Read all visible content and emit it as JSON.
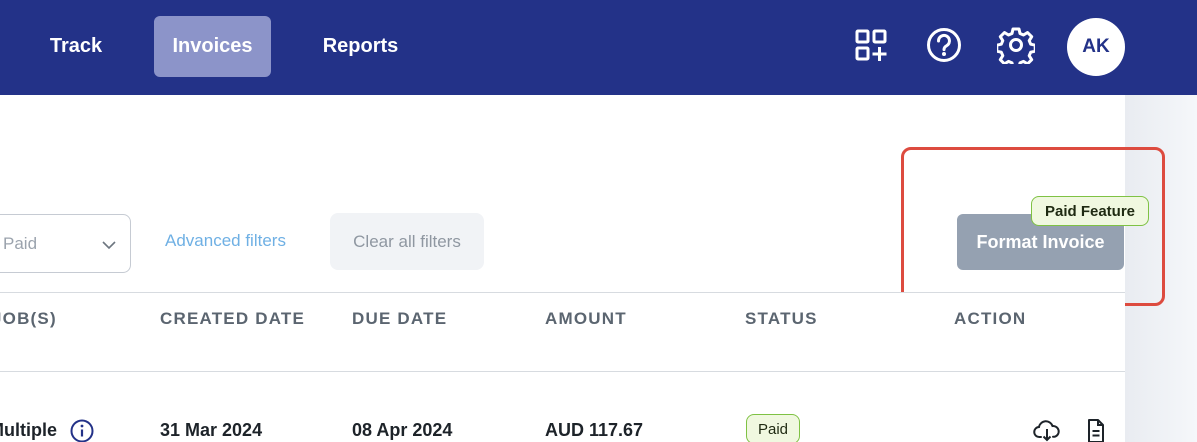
{
  "nav": {
    "items": [
      {
        "label": "Track"
      },
      {
        "label": "Invoices",
        "active": true
      },
      {
        "label": "Reports"
      }
    ],
    "icons": [
      "apps-add-icon",
      "help-icon",
      "settings-gear-icon"
    ],
    "avatar_initials": "AK"
  },
  "filters": {
    "status_value": "Paid",
    "advanced_filters_label": "Advanced filters",
    "clear_all_label": "Clear all filters"
  },
  "actions": {
    "format_invoice_label": "Format Invoice",
    "paid_feature_badge": "Paid Feature"
  },
  "table": {
    "columns": [
      "JOB(S)",
      "CREATED DATE",
      "DUE DATE",
      "AMOUNT",
      "STATUS",
      "ACTION"
    ],
    "rows": [
      {
        "jobs": "Multiple",
        "created_date": "31 Mar 2024",
        "due_date": "08 Apr 2024",
        "amount": "AUD 117.67",
        "status": "Paid",
        "action_icons": [
          "cloud-download-icon",
          "document-icon"
        ]
      }
    ]
  },
  "colors": {
    "nav_bg": "#233288",
    "active_tab_bg": "#8c94c9",
    "link": "#6fb0e4",
    "paid_border": "#7fc244",
    "highlight_border": "#dd4b3f",
    "disabled_button": "#95a1b1"
  }
}
